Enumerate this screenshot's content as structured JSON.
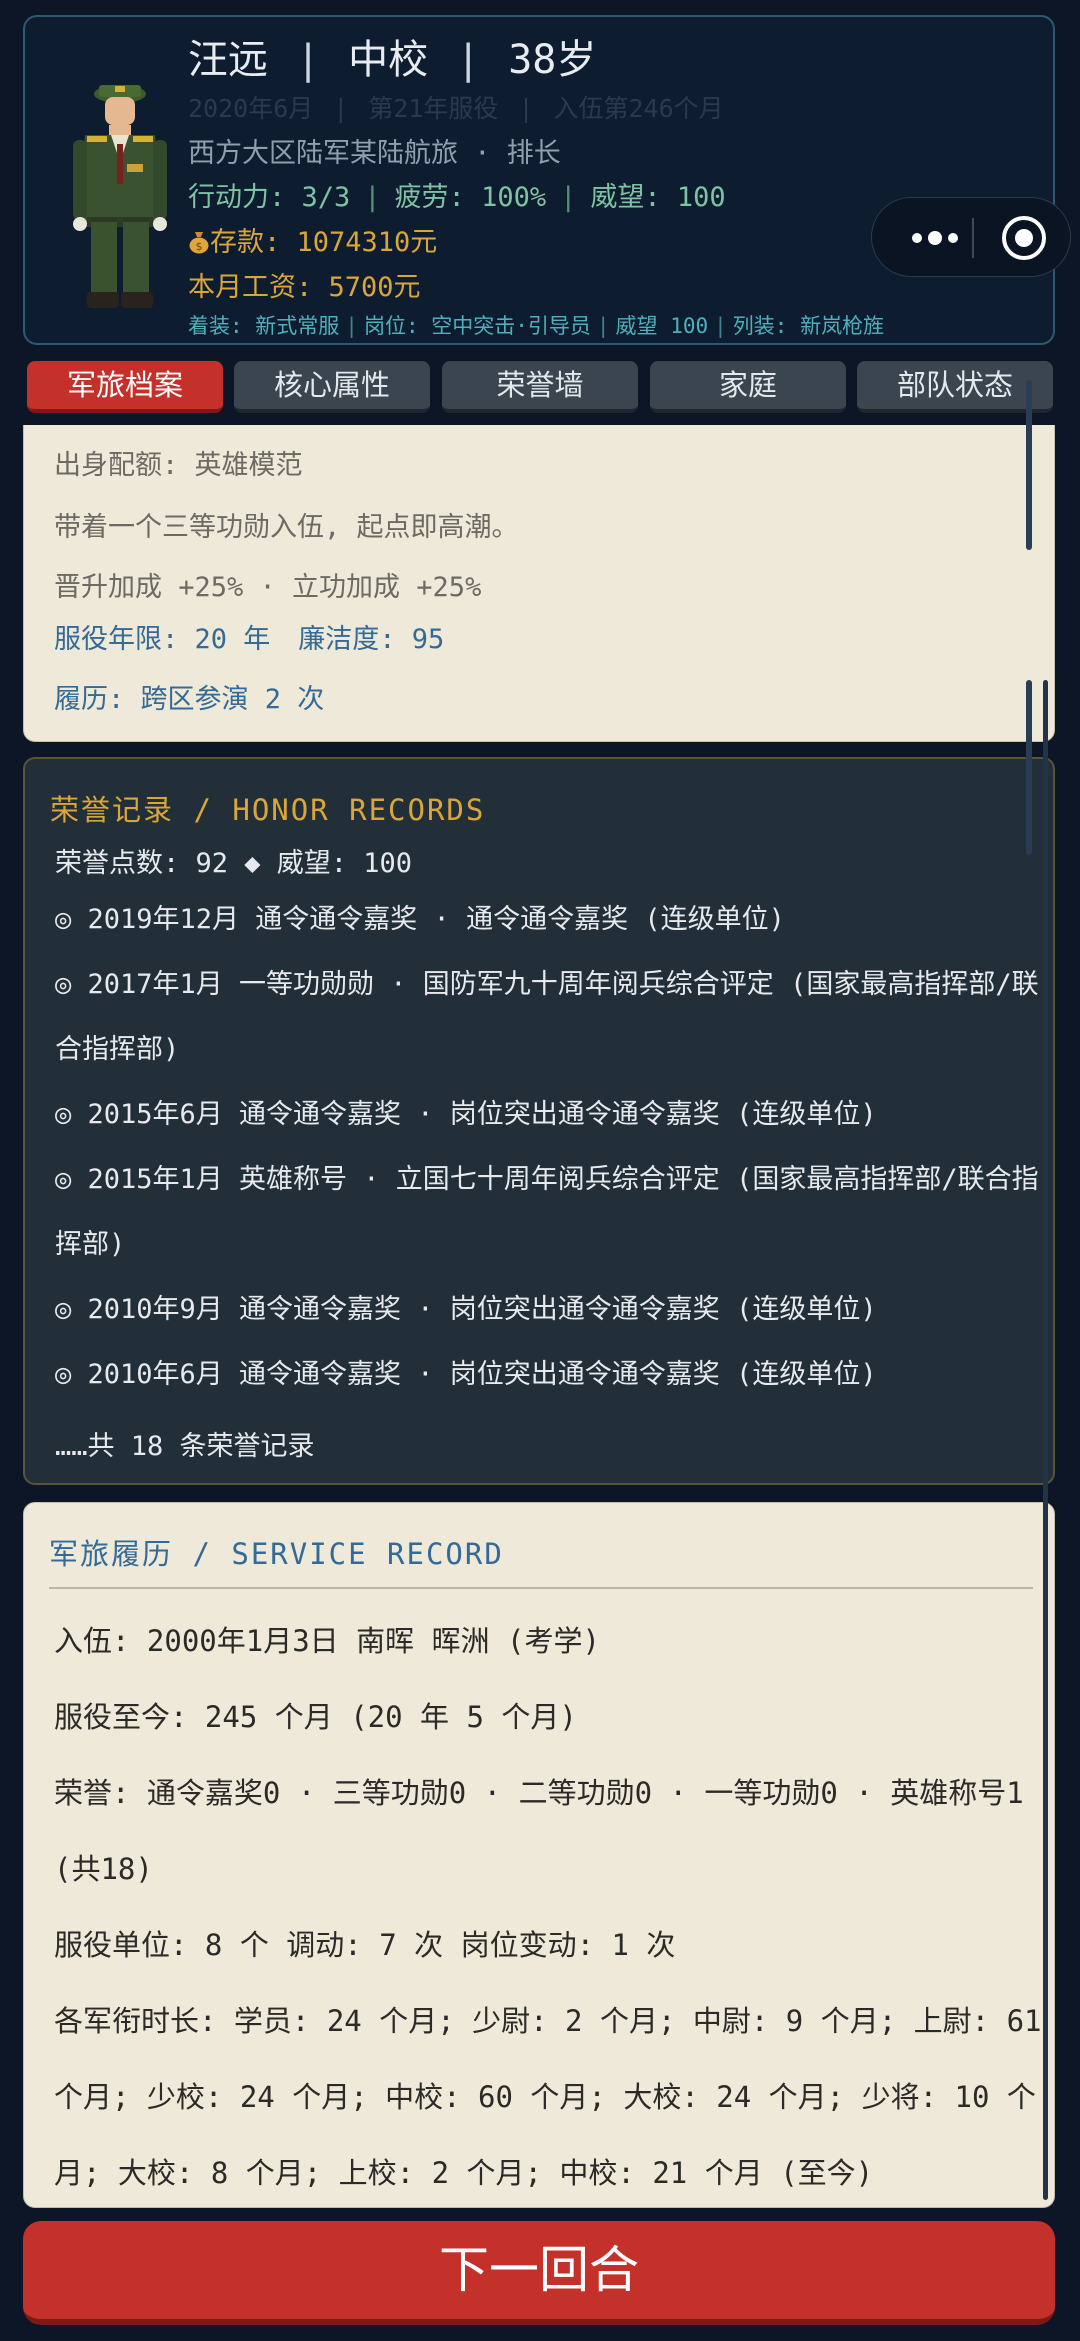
{
  "header": {
    "name": "汪远",
    "rank": "中校",
    "age": "38岁",
    "date": "2020年6月",
    "service_year": "第21年服役",
    "enlist_months": "入伍第246个月",
    "unit": "西方大区陆军某陆航旅",
    "position": "排长",
    "action_label": "行动力: ",
    "action_value": "3/3",
    "fatigue_label": "疲劳: ",
    "fatigue_value": "100%",
    "prestige_label": "威望: ",
    "prestige_value": "100",
    "savings": "存款: 1074310元",
    "salary": "本月工资: 5700元",
    "equip": {
      "uniform": "着装: 新式常服",
      "post": "岗位: 空中突击·引导员",
      "prestige": "威望 100",
      "gear": "列装: 新岚枪旌"
    }
  },
  "tabs": [
    "军旅档案",
    "核心属性",
    "荣誉墙",
    "家庭",
    "部队状态"
  ],
  "profile": {
    "origin": "出身配额: 英雄模范",
    "desc": "带着一个三等功勋入伍, 起点即高潮。",
    "bonus": "晋升加成 +25%  ·  立功加成 +25%",
    "service_years": "服役年限: 20 年",
    "integrity": "廉洁度: 95",
    "history": "履历: 跨区参演 2 次"
  },
  "honor": {
    "title": "荣誉记录 / HONOR RECORDS",
    "points": "荣誉点数: 92 ◆  威望: 100",
    "records": [
      "◎ 2019年12月 通令通令嘉奖  ·  通令通令嘉奖 (连级单位)",
      "◎ 2017年1月 一等功勋勋  ·  国防军九十周年阅兵综合评定 (国家最高指挥部/联合指挥部)",
      "◎ 2015年6月 通令通令嘉奖  ·  岗位突出通令通令嘉奖 (连级单位)",
      "◎ 2015年1月 英雄称号  ·  立国七十周年阅兵综合评定 (国家最高指挥部/联合指挥部)",
      "◎ 2010年9月 通令通令嘉奖  ·  岗位突出通令通令嘉奖 (连级单位)",
      "◎ 2010年6月 通令通令嘉奖  ·  岗位突出通令通令嘉奖 (连级单位)"
    ],
    "more": "……共 18 条荣誉记录"
  },
  "service": {
    "title": "军旅履历 / SERVICE RECORD",
    "enlist": "入伍: 2000年1月3日  南晖 晖洲  (考学)",
    "duration": "服役至今: 245 个月 (20 年 5 个月)",
    "honors": "荣誉: 通令嘉奖0  ·  三等功勋0  ·  二等功勋0  ·  一等功勋0  ·  英雄称号1 (共18)",
    "units": "服役单位: 8 个  调动: 7 次  岗位变动: 1 次",
    "ranks": "各军衔时长: 学员: 24 个月; 少尉: 2 个月; 中尉: 9 个月; 上尉: 61 个月; 少校: 24 个月; 中校: 60 个月; 大校: 24 个月; 少将: 10 个月; 大校: 8 个月; 上校: 2 个月; 中校: 21 个月 (至今)"
  },
  "next_turn": "下一回合",
  "colors": {
    "background": "#0c1626",
    "accent_red": "#c4312a",
    "gold": "#d9a63a",
    "teal": "#4fb0bc",
    "green": "#7fc3a2",
    "paper": "#efe9d9",
    "blue_text": "#336a98"
  }
}
